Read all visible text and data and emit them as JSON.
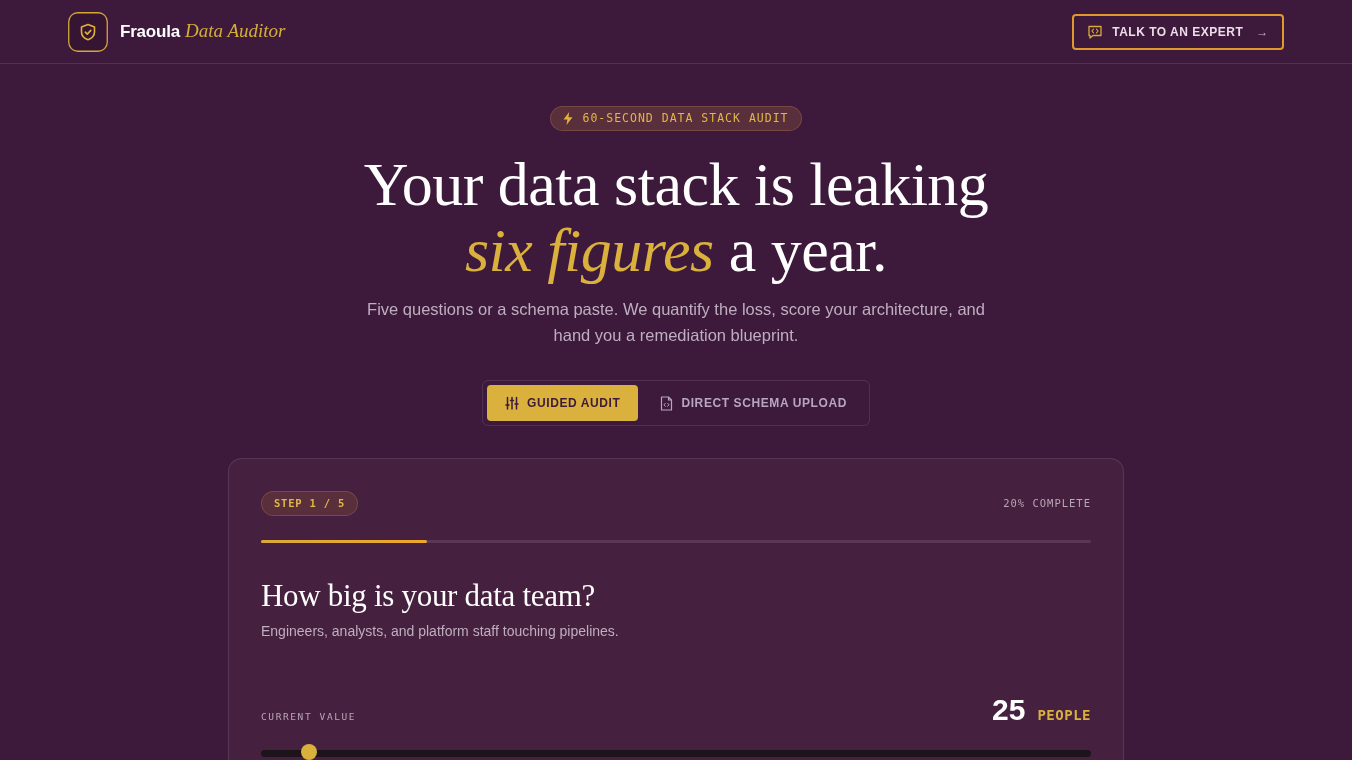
{
  "header": {
    "brand": {
      "name": "Fraoula",
      "product": "Data Auditor"
    },
    "cta": {
      "label": "TALK TO AN EXPERT",
      "arrow": "→"
    }
  },
  "hero": {
    "badge": "60-SECOND DATA STACK AUDIT",
    "title_lines": [
      "Your data stack is leaking",
      "*six figures* a year."
    ],
    "subtitle": "Five questions or a schema paste. We quantify the loss, score your architecture, and hand you a remediation blueprint."
  },
  "mode_tabs": [
    {
      "label": "GUIDED AUDIT",
      "selected": true
    },
    {
      "label": "DIRECT SCHEMA UPLOAD",
      "selected": false
    }
  ],
  "card": {
    "step": "STEP 1 / 5",
    "progress": {
      "label": "20% COMPLETE",
      "level": 0.2
    },
    "question": "How big is your data team?",
    "hint": "Engineers, analysts, and platform staff touching pipelines.",
    "value_label": "CURRENT VALUE",
    "value": "25",
    "unit": "PEOPLE",
    "slider": {
      "level": 0.058
    }
  }
}
